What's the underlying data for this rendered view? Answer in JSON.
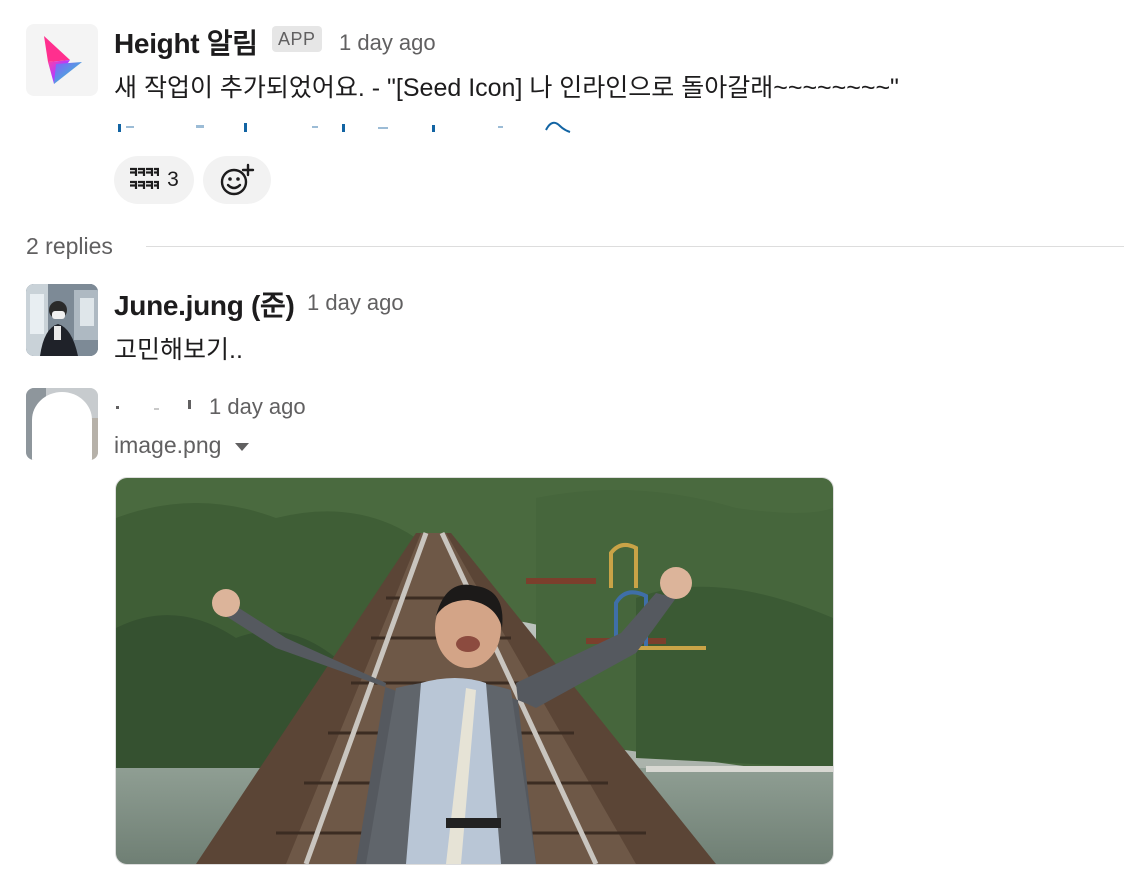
{
  "parent_message": {
    "sender": "Height 알림",
    "badge": "APP",
    "time": "1 day ago",
    "text": "새 작업이 추가되었어요. - \"[Seed Icon] 나 인라인으로 돌아갈래~~~~~~~~\"",
    "reaction": {
      "emoji": "ㅋㅋㅋㅋ",
      "count": "3"
    }
  },
  "thread": {
    "replies_label": "2 replies"
  },
  "replies": [
    {
      "sender": "June.jung (준)",
      "time": "1 day ago",
      "text": "고민해보기.."
    },
    {
      "sender": "",
      "time": "1 day ago",
      "file_name": "image.png"
    }
  ],
  "colors": {
    "link": "#1264a3",
    "muted": "#616061",
    "reaction_bg": "#f2f2f2",
    "divider": "#dddddd"
  },
  "icons": {
    "app": "height-logo-icon",
    "add_reaction": "add-emoji-icon",
    "file_menu": "caret-down-icon"
  }
}
